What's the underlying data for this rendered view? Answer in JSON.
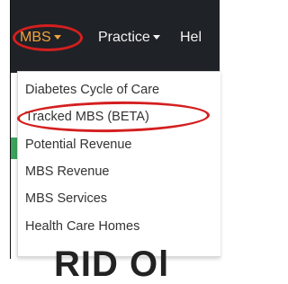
{
  "navbar": {
    "items": [
      {
        "label": "MBS",
        "active": true
      },
      {
        "label": "Practice"
      },
      {
        "label": "Hel"
      }
    ]
  },
  "dropdown": {
    "items": [
      {
        "label": "Diabetes Cycle of Care"
      },
      {
        "label": "Tracked MBS (BETA)"
      },
      {
        "label": "Potential Revenue"
      },
      {
        "label": "MBS Revenue"
      },
      {
        "label": "MBS Services"
      },
      {
        "label": "Health Care Homes"
      }
    ]
  },
  "background": {
    "partial_heading": "RID Ol"
  },
  "colors": {
    "navbar_bg": "#1f2226",
    "active_nav": "#f3a23a",
    "annotation": "#d41f1f"
  }
}
